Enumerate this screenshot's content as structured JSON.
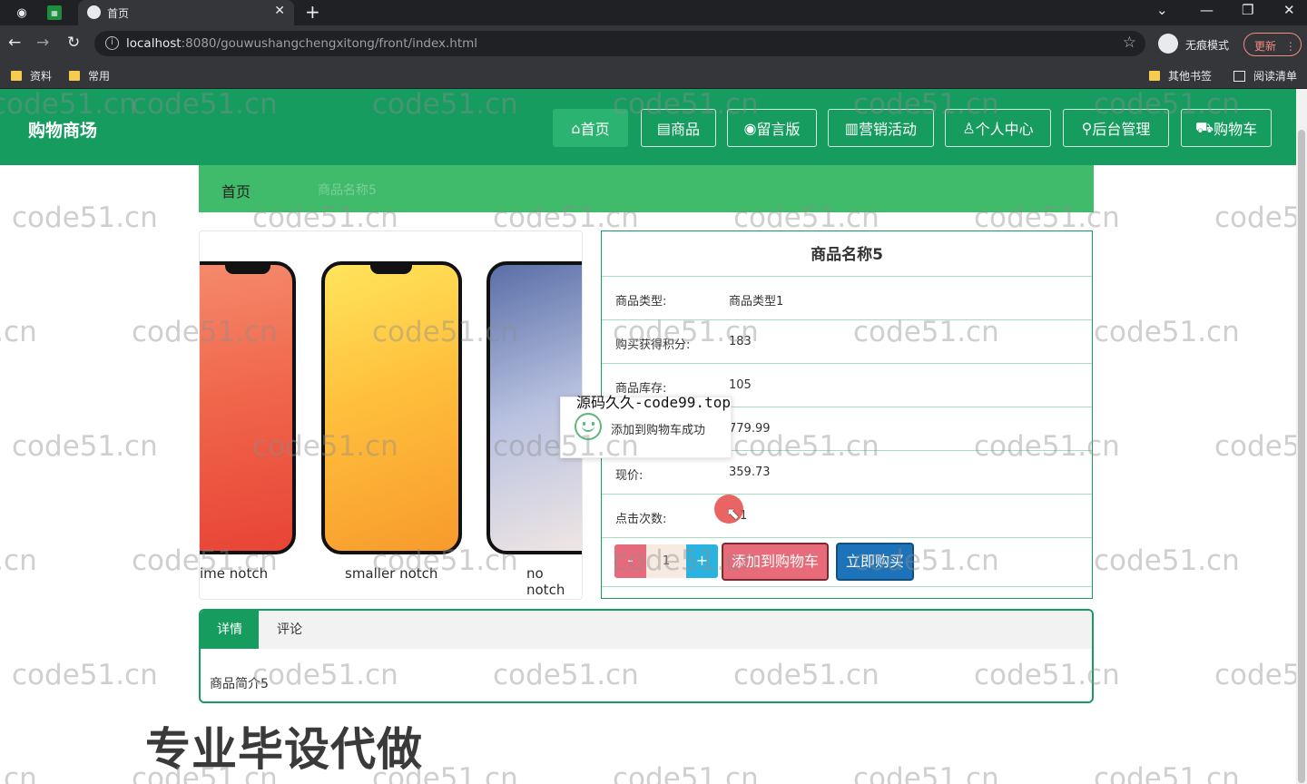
{
  "browser": {
    "tab_title": "首页",
    "url_host": "localhost",
    "url_rest": ":8080/gouwushangchengxitong/front/index.html",
    "incognito_label": "无痕模式",
    "update_label": "更新",
    "bookmarks": [
      "资料",
      "常用"
    ],
    "bookmarks_right": [
      "其他书签",
      "阅读清单"
    ]
  },
  "site": {
    "logo": "购物商场",
    "nav": [
      {
        "label": "首页",
        "icon": "home-icon",
        "glyph": "⌂"
      },
      {
        "label": "商品",
        "icon": "goods-icon",
        "glyph": "▤"
      },
      {
        "label": "留言版",
        "icon": "message-icon",
        "glyph": "◉"
      },
      {
        "label": "营销活动",
        "icon": "activity-icon",
        "glyph": "▥"
      },
      {
        "label": "个人中心",
        "icon": "user-icon",
        "glyph": "♙"
      },
      {
        "label": "后台管理",
        "icon": "link-icon",
        "glyph": "⚲"
      },
      {
        "label": "购物车",
        "icon": "cart-icon",
        "glyph": "⛟"
      }
    ]
  },
  "breadcrumb": {
    "home": "首页",
    "current": "商品名称5"
  },
  "product": {
    "image_labels": [
      "ime notch",
      "smaller notch",
      "no notch"
    ],
    "name": "商品名称5",
    "rows": [
      {
        "label": "商品类型:",
        "value": "商品类型1"
      },
      {
        "label": "购买获得积分:",
        "value": "183"
      },
      {
        "label": "商品库存:",
        "value": "105"
      },
      {
        "label": "",
        "value": "779.99"
      },
      {
        "label": "现价:",
        "value": "359.73"
      },
      {
        "label": "点击次数:",
        "value": "1"
      }
    ],
    "quantity": "1",
    "minus": "-",
    "plus": "+",
    "add_to_cart": "添加到购物车",
    "buy_now": "立即购买"
  },
  "toast": {
    "message": "添加到购物车成功",
    "overlay": "源码久久-code99.top"
  },
  "tabs": {
    "detail": "详情",
    "comment": "评论",
    "content": "商品简介5"
  },
  "promo": "专业毕设代做",
  "watermark": "code51.cn",
  "colors": {
    "primary": "#169c5f",
    "breadcrumb": "#3fbb6b",
    "add_cart": "#e76b79",
    "buy_now": "#1d73b9",
    "toast_icon": "#5fb878"
  }
}
